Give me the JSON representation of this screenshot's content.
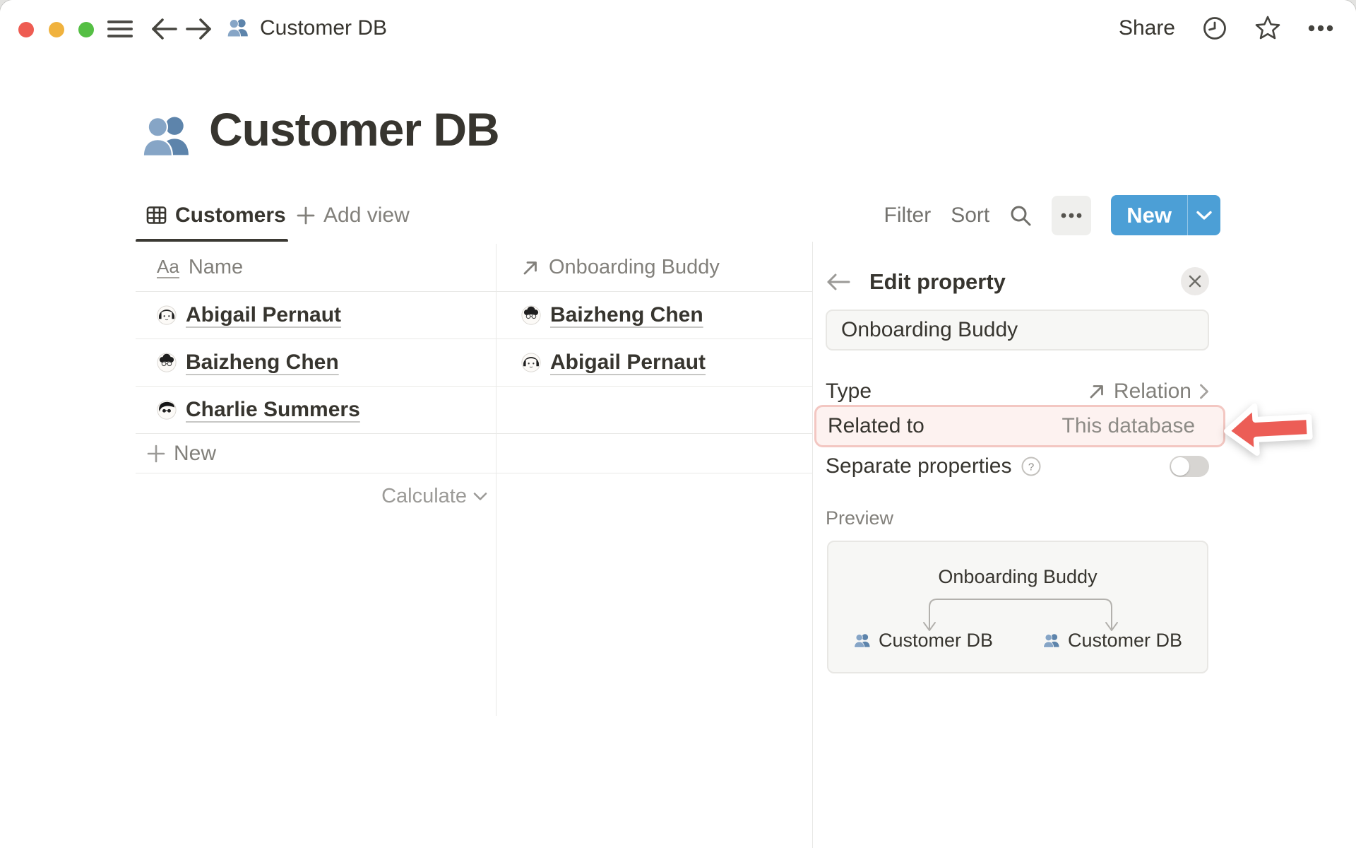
{
  "titlebar": {
    "title": "Customer DB",
    "share_label": "Share"
  },
  "page": {
    "title": "Customer DB"
  },
  "view_bar": {
    "active_tab": "Customers",
    "add_view_label": "Add view",
    "filter_label": "Filter",
    "sort_label": "Sort",
    "new_button_label": "New"
  },
  "table": {
    "columns": [
      {
        "icon": "Aa",
        "label": "Name"
      },
      {
        "label": "Onboarding Buddy"
      }
    ],
    "rows": [
      {
        "name": "Abigail Pernaut",
        "buddy": "Baizheng Chen"
      },
      {
        "name": "Baizheng Chen",
        "buddy": "Abigail Pernaut"
      },
      {
        "name": "Charlie Summers",
        "buddy": ""
      }
    ],
    "new_row_label": "New",
    "calculate_label": "Calculate"
  },
  "panel": {
    "title": "Edit property",
    "name_input": "Onboarding Buddy",
    "type_label": "Type",
    "type_value": "Relation",
    "related_label": "Related to",
    "related_value": "This database",
    "separate_label": "Separate properties",
    "separate_toggle_on": false,
    "preview_label": "Preview",
    "preview": {
      "node": "Onboarding Buddy",
      "left_target": "Customer DB",
      "right_target": "Customer DB"
    }
  },
  "colors": {
    "accent_blue": "#4C9FD6",
    "highlight_bg": "#FDF2F0",
    "highlight_border": "#F3C7C2",
    "annotation_red": "#EC5D56",
    "text_primary": "#37352F",
    "text_gray": "#82807B"
  }
}
